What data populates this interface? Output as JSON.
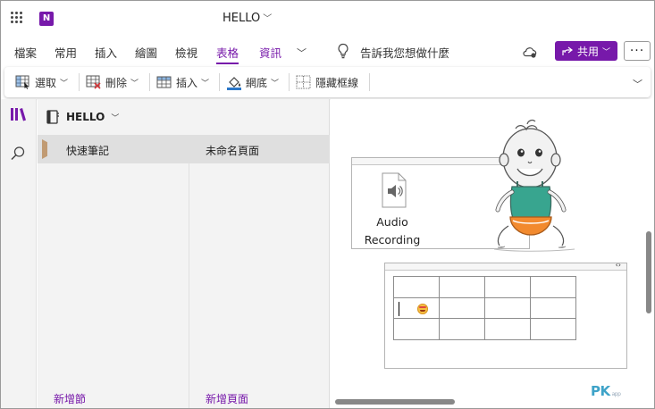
{
  "window": {
    "app_badge": "N",
    "title": "HELLO"
  },
  "menu": {
    "tabs": [
      "檔案",
      "常用",
      "插入",
      "繪圖",
      "檢視",
      "表格",
      "資訊"
    ],
    "active_tab": "表格",
    "tell_me": "告訴我您想做什麼",
    "share_label": "共用",
    "more_label": "···"
  },
  "ribbon": {
    "select": "選取",
    "delete": "刪除",
    "insert": "插入",
    "shading": "網底",
    "hide_borders": "隱藏框線"
  },
  "notebook": {
    "name": "HELLO",
    "sections": [
      "快速筆記"
    ],
    "pages": [
      "未命名頁面"
    ],
    "add_section": "新增節",
    "add_page": "新增頁面"
  },
  "canvas": {
    "audio_label_line1": "Audio",
    "audio_label_line2": "Recording",
    "table": {
      "rows": 3,
      "cols": 4
    },
    "watermark_main": "PK",
    "watermark_sub": "app"
  },
  "colors": {
    "accent": "#7719aa",
    "section_tab": "#c19b73",
    "watermark": "#3ea3c8"
  },
  "icons": [
    "apps-grid-icon",
    "onenote-logo-icon",
    "lightbulb-icon",
    "cloud-sync-icon",
    "library-icon",
    "search-icon",
    "notebook-icon",
    "speaker-file-icon"
  ]
}
